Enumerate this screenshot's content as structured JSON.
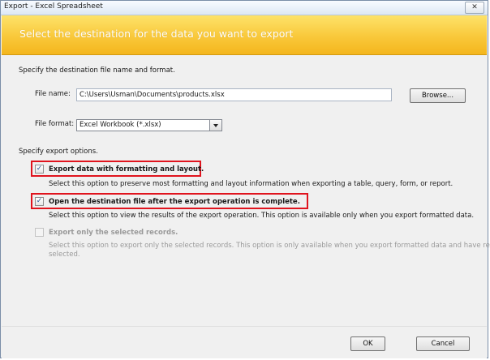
{
  "window": {
    "title": "Export - Excel Spreadsheet"
  },
  "banner": {
    "heading": "Select the destination for the data you want to export"
  },
  "destination": {
    "intro": "Specify the destination file name and format.",
    "file_name_label": "File name:",
    "file_name_value": "C:\\Users\\Usman\\Documents\\products.xlsx",
    "browse_label": "Browse...",
    "file_format_label": "File format:",
    "file_format_value": "Excel Workbook (*.xlsx)"
  },
  "options": {
    "heading": "Specify export options.",
    "items": [
      {
        "label": "Export data with formatting and layout.",
        "description": "Select this option to preserve most formatting and layout information when exporting a table, query, form, or report.",
        "checked": true,
        "enabled": true
      },
      {
        "label": "Open the destination file after the export operation is complete.",
        "description": "Select this option to view the results of the export operation. This option is available only when you export formatted data.",
        "checked": true,
        "enabled": true
      },
      {
        "label": "Export only the selected records.",
        "description": "Select this option to export only the selected records. This option is only available when you export formatted data and have records",
        "description2": "selected.",
        "checked": false,
        "enabled": false
      }
    ]
  },
  "footer": {
    "ok_label": "OK",
    "cancel_label": "Cancel"
  },
  "colors": {
    "banner": "#f9c83a",
    "highlight": "#e0141e",
    "check": "#2a5a9a"
  }
}
